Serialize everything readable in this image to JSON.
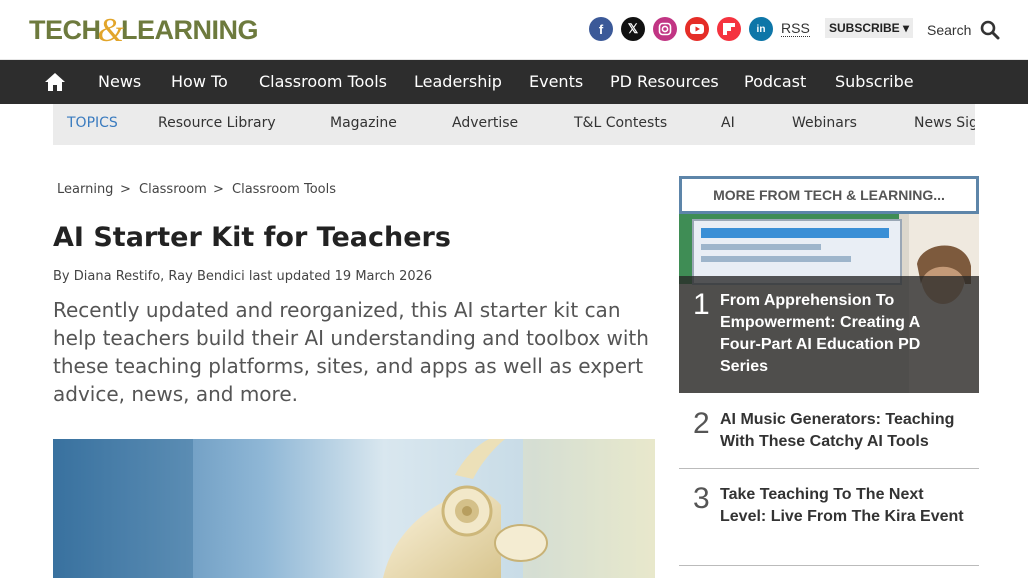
{
  "header": {
    "logo_left": "TECH",
    "logo_amp": "&",
    "logo_right": "LEARNING",
    "rss": "RSS",
    "subscribe": "SUBSCRIBE",
    "search": "Search",
    "socials": [
      "facebook-icon",
      "x-icon",
      "instagram-icon",
      "youtube-icon",
      "flipboard-icon",
      "linkedin-icon"
    ]
  },
  "nav": {
    "items": [
      "News",
      "How To",
      "Classroom Tools",
      "Leadership",
      "Events",
      "PD Resources",
      "Podcast",
      "Subscribe"
    ]
  },
  "topics": {
    "label": "TOPICS",
    "items": [
      "Resource Library",
      "Magazine",
      "Advertise",
      "T&L Contests",
      "AI",
      "Webinars",
      "News Sig"
    ]
  },
  "breadcrumb": {
    "items": [
      "Learning",
      "Classroom",
      "Classroom Tools"
    ],
    "separator": ">"
  },
  "article": {
    "title": "AI Starter Kit for Teachers",
    "byline_prefix": "By",
    "authors": "Diana Restifo, Ray Bendici",
    "updated": "last updated 19 March 2026",
    "lede": "Recently updated and reorganized, this AI starter kit can help teachers build their AI understanding and toolbox with these teaching platforms, sites, and apps as well as expert advice, news, and more."
  },
  "sidebar": {
    "heading": "MORE FROM TECH & LEARNING...",
    "items": [
      {
        "num": "1",
        "title": "From Apprehension To Empowerment: Creating A Four-Part AI Education PD Series"
      },
      {
        "num": "2",
        "title": "AI Music Generators: Teaching With These Catchy AI Tools"
      },
      {
        "num": "3",
        "title": "Take Teaching To The Next Level: Live From The Kira Event"
      }
    ]
  },
  "colors": {
    "nav_bg": "#2d2d2d",
    "topics_bg": "#ebebeb",
    "topics_label": "#3a7bbf",
    "logo_green": "#6d7a3d",
    "logo_amp": "#e2a52a",
    "sidebar_border": "#5d85a9"
  }
}
